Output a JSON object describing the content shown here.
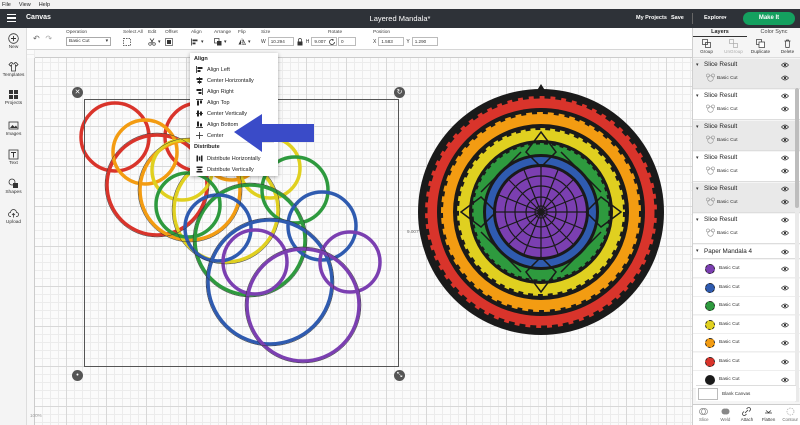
{
  "menubar": {
    "items": [
      "File",
      "View",
      "Help"
    ]
  },
  "titlebar": {
    "app_title": "Canvas",
    "doc_title": "Layered Mandala*",
    "my_projects": "My Projects",
    "save": "Save",
    "machine": "Explore",
    "make_it": "Make It"
  },
  "toolbar": {
    "operation_label": "Operation",
    "operation_value": "Basic Cut",
    "select_all": "Select All",
    "edit": "Edit",
    "offset": "Offset",
    "align": "Align",
    "arrange": "Arrange",
    "flip": "Flip",
    "size": "Size",
    "size_w_label": "W",
    "size_w": "10.294",
    "size_h_label": "H",
    "size_h": "9.007",
    "rotate": "Rotate",
    "rotate_value": "0",
    "position": "Position",
    "pos_x_label": "X",
    "pos_x": "1.583",
    "pos_y_label": "Y",
    "pos_y": "1.290"
  },
  "sidebar": {
    "items": [
      {
        "label": "New",
        "icon": "plus-icon"
      },
      {
        "label": "Templates",
        "icon": "shirt-icon"
      },
      {
        "label": "Projects",
        "icon": "grid-icon"
      },
      {
        "label": "Images",
        "icon": "image-icon"
      },
      {
        "label": "Text",
        "icon": "text-icon"
      },
      {
        "label": "Shapes",
        "icon": "shapes-icon"
      },
      {
        "label": "Upload",
        "icon": "upload-icon"
      }
    ]
  },
  "align_menu": {
    "heading": "Align",
    "items": [
      "Align Left",
      "Center Horizontally",
      "Align Right",
      "Align Top",
      "Center Vertically",
      "Align Bottom",
      "Center"
    ],
    "distribute_heading": "Distribute",
    "distribute_items": [
      "Distribute Horizontally",
      "Distribute Vertically"
    ]
  },
  "canvas": {
    "height_dim": "9.007\"",
    "zoom": "100%"
  },
  "layers_panel": {
    "tabs": [
      "Layers",
      "Color Sync"
    ],
    "tools": [
      "Group",
      "UnGroup",
      "Duplicate",
      "Delete"
    ],
    "slice_groups": [
      {
        "title": "Slice Result",
        "sub": "Basic Cut"
      },
      {
        "title": "Slice Result",
        "sub": "Basic Cut"
      },
      {
        "title": "Slice Result",
        "sub": "Basic Cut"
      },
      {
        "title": "Slice Result",
        "sub": "Basic Cut"
      },
      {
        "title": "Slice Result",
        "sub": "Basic Cut"
      },
      {
        "title": "Slice Result",
        "sub": "Basic Cut"
      }
    ],
    "mandala_title": "Paper Mandala 4",
    "mandala_rows": [
      {
        "label": "Basic Cut",
        "color": "#7b3fb1"
      },
      {
        "label": "Basic Cut",
        "color": "#2f5bb0"
      },
      {
        "label": "Basic Cut",
        "color": "#2e9a3e"
      },
      {
        "label": "Basic Cut",
        "color": "#e0d020"
      },
      {
        "label": "Basic Cut",
        "color": "#f39c12"
      },
      {
        "label": "Basic Cut",
        "color": "#d9342b"
      },
      {
        "label": "Basic Cut",
        "color": "#1a1a1a"
      }
    ],
    "blank_canvas": "Blank Canvas",
    "footer": [
      "Slice",
      "Weld",
      "Attach",
      "Flatten",
      "Contour"
    ]
  },
  "colors": {
    "make_it": "#14a05f",
    "titlebar": "#2e3238",
    "arrow": "#3a4bc8"
  }
}
